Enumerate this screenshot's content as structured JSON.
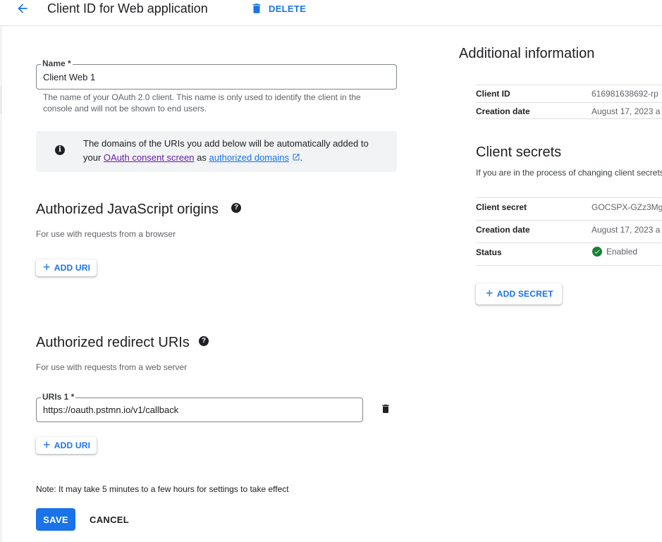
{
  "header": {
    "title": "Client ID for Web application",
    "delete_label": "DELETE"
  },
  "name_field": {
    "label": "Name *",
    "value": "Client Web 1",
    "helper": "The name of your OAuth 2.0 client. This name is only used to identify the client in the console and will not be shown to end users."
  },
  "info_notice": {
    "text_before": "The domains of the URIs you add below will be automatically added to your ",
    "link1": "OAuth consent screen",
    "text_middle": " as ",
    "link2": "authorized domains",
    "text_after": "."
  },
  "js_origins": {
    "title": "Authorized JavaScript origins",
    "subtitle": "For use with requests from a browser",
    "add_label": "ADD URI"
  },
  "redirect_uris": {
    "title": "Authorized redirect URIs",
    "subtitle": "For use with requests from a web server",
    "uris": [
      {
        "label": "URIs 1 *",
        "value": "https://oauth.pstmn.io/v1/callback"
      }
    ],
    "add_label": "ADD URI"
  },
  "footer": {
    "note": "Note: It may take 5 minutes to a few hours for settings to take effect",
    "save_label": "SAVE",
    "cancel_label": "CANCEL"
  },
  "additional_info": {
    "title": "Additional information",
    "rows": [
      {
        "key": "Client ID",
        "value": "616981638692-rp"
      },
      {
        "key": "Creation date",
        "value": "August 17, 2023 a"
      }
    ]
  },
  "client_secrets": {
    "title": "Client secrets",
    "description": "If you are in the process of changing client secrets",
    "rows": [
      {
        "key": "Client secret",
        "value": "GOCSPX-GZz3Mg"
      },
      {
        "key": "Creation date",
        "value": "August 17, 2023 a"
      },
      {
        "key": "Status",
        "value": "Enabled"
      }
    ],
    "add_label": "ADD SECRET"
  },
  "colors": {
    "primary": "#1a73e8",
    "success": "#188038",
    "visited_link": "#681da8"
  },
  "icons": [
    "arrow-back-icon",
    "trash-icon",
    "info-icon",
    "help-icon",
    "plus-icon",
    "external-link-icon",
    "check-circle-icon"
  ]
}
